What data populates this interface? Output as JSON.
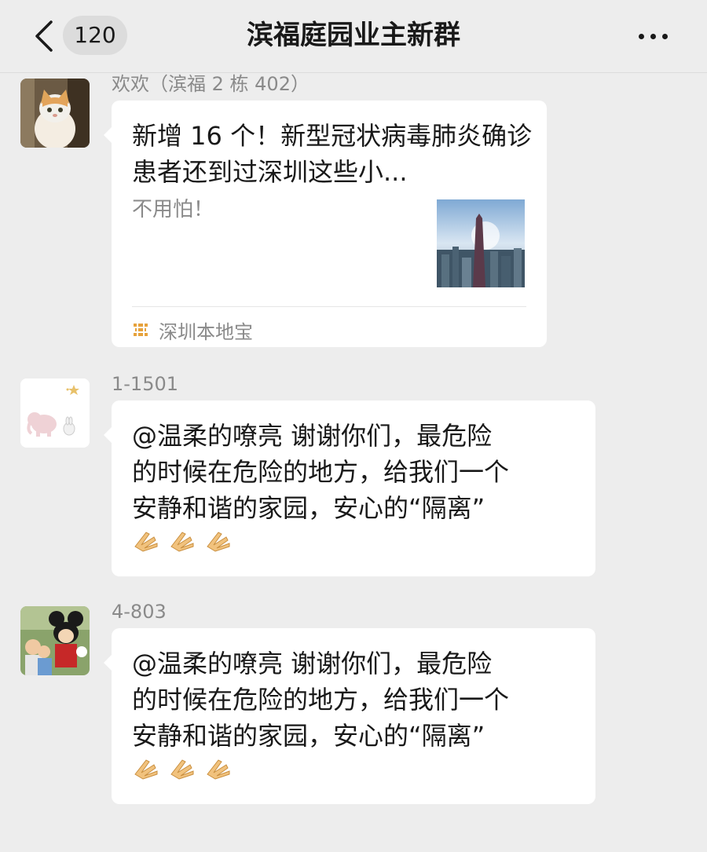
{
  "header": {
    "back_label": "<",
    "unread_count": "120",
    "title": "滨福庭园业主新群",
    "more_label": "..."
  },
  "messages": [
    {
      "sender": "欢欢（滨福 2 栋 402）",
      "type": "link_card",
      "card": {
        "title": "新增 16 个！新型冠状病毒肺炎确诊患者还到过深圳这些小...",
        "description": "不用怕！",
        "source": "深圳本地宝",
        "thumbnail_icon": "city-skyline-image",
        "source_icon": "mini-program-icon"
      },
      "avatar_icon": "cat-avatar"
    },
    {
      "sender": "1-1501",
      "type": "text",
      "text": "@温柔的嘹亮 谢谢你们，最危险\n的时候在危险的地方，给我们一个\n安静和谐的家园，安心的“隔离”",
      "emoji": [
        "clap-emoji",
        "clap-emoji",
        "clap-emoji"
      ],
      "avatar_icon": "elephant-avatar"
    },
    {
      "sender": "4-803",
      "type": "text",
      "text": "@温柔的嘹亮 谢谢你们，最危险\n的时候在危险的地方，给我们一个\n安静和谐的家园，安心的“隔离”",
      "emoji": [
        "clap-emoji",
        "clap-emoji",
        "clap-emoji"
      ],
      "avatar_icon": "mickey-photo-avatar"
    }
  ],
  "colors": {
    "background": "#ededed",
    "bubble": "#ffffff",
    "secondary_text": "#8a8a8a",
    "badge": "#dcdcdc"
  }
}
